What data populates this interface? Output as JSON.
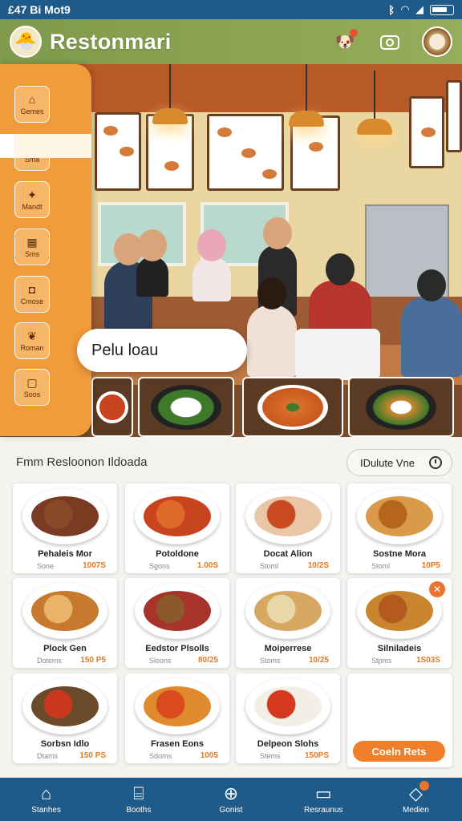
{
  "status_bar": {
    "time": "£47 Bi Mot9"
  },
  "header": {
    "app_title": "Restonmari",
    "logo_icon": "chef-mascot-icon",
    "actions": [
      "mascot-notification-icon",
      "camera-icon",
      "food-plate-avatar"
    ]
  },
  "sidebar": {
    "items": [
      {
        "label": "Gemes",
        "icon": "menu-icon"
      },
      {
        "label": "Sma",
        "icon": "heart-food-icon"
      },
      {
        "label": "Mandt",
        "icon": "map-icon"
      },
      {
        "label": "Sms",
        "icon": "calendar-icon"
      },
      {
        "label": "Cmose",
        "icon": "chat-icon"
      },
      {
        "label": "Roman",
        "icon": "leaf-icon"
      },
      {
        "label": "Soos",
        "icon": "bag-icon"
      }
    ],
    "active_index": 1
  },
  "hero": {
    "search_text": "Pelu loau"
  },
  "section": {
    "title": "Fmm Resloonon Ildoada",
    "filter_label": "IDulute Vne"
  },
  "dishes": [
    {
      "name": "Pehaleis Mor",
      "sub": "Sone",
      "price": "1007S",
      "colors": [
        "#7a3b22",
        "#8a4a2a"
      ]
    },
    {
      "name": "Potoldone",
      "sub": "Sgons",
      "price": "1.00S",
      "colors": [
        "#c8441e",
        "#e06a2a"
      ]
    },
    {
      "name": "Docat Alion",
      "sub": "Stoml",
      "price": "10/2S",
      "colors": [
        "#e9c6a5",
        "#c94a1e"
      ]
    },
    {
      "name": "Sostne Mora",
      "sub": "Stoml",
      "price": "10P5",
      "colors": [
        "#d99a4a",
        "#b5651d"
      ]
    },
    {
      "name": "Plock Gen",
      "sub": "Dotems",
      "price": "150 P5",
      "colors": [
        "#c77a2e",
        "#e9b46a"
      ]
    },
    {
      "name": "Eedstor Plsolls",
      "sub": "Sloons",
      "price": "80/25",
      "colors": [
        "#a8332a",
        "#8a5a2a"
      ]
    },
    {
      "name": "Moiperrese",
      "sub": "Stoms",
      "price": "10/25",
      "colors": [
        "#d6a862",
        "#e8d8a8"
      ]
    },
    {
      "name": "Silniladeis",
      "sub": "Stpms",
      "price": "1S03S",
      "colors": [
        "#c9862e",
        "#b35a1e"
      ]
    },
    {
      "name": "Sorbsn Idlo",
      "sub": "Dtams",
      "price": "150 PS",
      "colors": [
        "#6b4a2a",
        "#c9381e"
      ]
    },
    {
      "name": "Frasen Eons",
      "sub": "Sdoms",
      "price": "1005",
      "colors": [
        "#e08a2e",
        "#d94a1e"
      ]
    },
    {
      "name": "Delpeon Slohs",
      "sub": "Stems",
      "price": "150PS",
      "colors": [
        "#f2efe6",
        "#d6381e"
      ]
    }
  ],
  "cta": {
    "label": "Coeln Rets"
  },
  "bottom_nav": [
    {
      "label": "Stanhes",
      "icon": "home-icon"
    },
    {
      "label": "Booths",
      "icon": "store-icon"
    },
    {
      "label": "Gonist",
      "icon": "globe-icon"
    },
    {
      "label": "Resraunus",
      "icon": "laptop-icon"
    },
    {
      "label": "Medien",
      "icon": "tag-icon"
    }
  ],
  "colors": {
    "primary": "#1f5b8a",
    "accent": "#f29b3b",
    "header": "#8aa553",
    "price": "#e07a25"
  }
}
